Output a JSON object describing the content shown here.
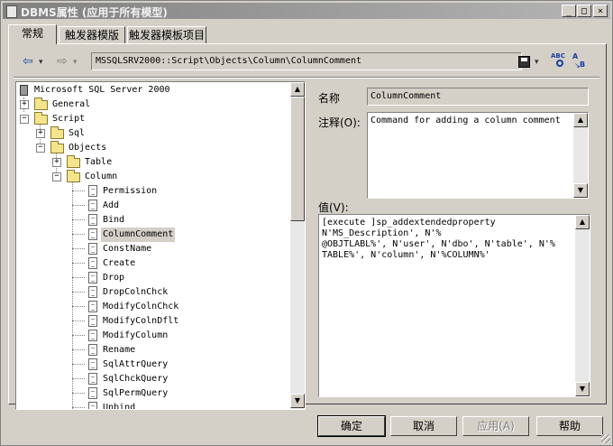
{
  "window": {
    "title": "DBMS属性 (应用于所有模型)"
  },
  "title_buttons": {
    "minimize": "_",
    "maximize": "□",
    "close": "×"
  },
  "tabs": [
    {
      "label": "常规"
    },
    {
      "label": "触发器模版"
    },
    {
      "label": "触发器模板项目"
    }
  ],
  "toolbar": {
    "path": "MSSQLSRV2000::Script\\Objects\\Column\\ColumnComment",
    "back_glyph": "⇦",
    "forward_glyph": "⇨",
    "dropdown_glyph": "▾"
  },
  "tree": {
    "items": [
      {
        "label": "Microsoft SQL Server 2000",
        "type": "root"
      },
      {
        "label": "General",
        "type": "folder"
      },
      {
        "label": "Script",
        "type": "folder"
      },
      {
        "label": "Sql",
        "type": "folder"
      },
      {
        "label": "Objects",
        "type": "folder"
      },
      {
        "label": "Table",
        "type": "folder"
      },
      {
        "label": "Column",
        "type": "folder"
      },
      {
        "label": "Permission",
        "type": "doc"
      },
      {
        "label": "Add",
        "type": "doc"
      },
      {
        "label": "Bind",
        "type": "doc"
      },
      {
        "label": "ColumnComment",
        "type": "doc"
      },
      {
        "label": "ConstName",
        "type": "doc"
      },
      {
        "label": "Create",
        "type": "doc"
      },
      {
        "label": "Drop",
        "type": "doc"
      },
      {
        "label": "DropColnChck",
        "type": "doc"
      },
      {
        "label": "ModifyColnChck",
        "type": "doc"
      },
      {
        "label": "ModifyColnDflt",
        "type": "doc"
      },
      {
        "label": "ModifyColumn",
        "type": "doc"
      },
      {
        "label": "Rename",
        "type": "doc"
      },
      {
        "label": "SqlAttrQuery",
        "type": "doc"
      },
      {
        "label": "SqlChckQuery",
        "type": "doc"
      },
      {
        "label": "SqlPermQuery",
        "type": "doc"
      },
      {
        "label": "Unbind",
        "type": "doc"
      }
    ],
    "selected": "ColumnComment"
  },
  "props": {
    "name_label": "名称",
    "name_value": "ColumnComment",
    "comment_label": "注释(O):",
    "comment_value": "Command for adding a column comment",
    "value_label": "值(V):",
    "value_text": "[execute ]sp_addextendedproperty\nN'MS_Description', N'%\n@OBJTLABL%', N'user', N'dbo', N'table', N'%\nTABLE%', N'column', N'%COLUMN%'"
  },
  "buttons": {
    "ok": "确定",
    "cancel": "取消",
    "apply": "应用(A)",
    "help": "帮助"
  }
}
